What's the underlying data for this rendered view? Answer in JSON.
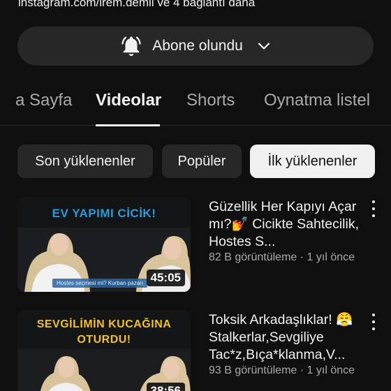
{
  "header": {
    "link_line": "instagram.com/irem.demil ve 4 bağlantı daha"
  },
  "subscribe": {
    "label": "Abone olundu",
    "icon": "bell-icon"
  },
  "tabs": [
    {
      "label": "a Sayfa",
      "active": false
    },
    {
      "label": "Videolar",
      "active": true
    },
    {
      "label": "Shorts",
      "active": false
    },
    {
      "label": "Oynatma listel",
      "active": false
    }
  ],
  "chips": [
    {
      "label": "Son yüklenenler",
      "selected": false
    },
    {
      "label": "Popüler",
      "selected": false
    },
    {
      "label": "İlk yüklenenler",
      "selected": true
    }
  ],
  "videos": [
    {
      "thumb_text": "EV YAPIMI CİCİK!",
      "thumb_subtitle": "Hostes seçmesi mi? Kurban pazarı",
      "duration": "45:05",
      "title": "Güzellik Her Kapıyı Açar mı?💅 Cicikte Sahtecilik, Hostes S...",
      "meta": "82 B görüntüleme · 1 yıl önce"
    },
    {
      "thumb_text_line1": "SEVGİLİMİN KUCAĞINA",
      "thumb_text_line2": "OTURDU!",
      "duration": "38:56",
      "title": "Toksik Arkadaşlıklar! 😤 Stalkerlar,Sevgiliye Tac*z,Bıça*klanma,V...",
      "meta": "93 B görüntüleme · 1 yıl önce"
    }
  ],
  "colors": {
    "background": "#0f0f0f",
    "chip": "#272727",
    "chip_selected": "#f1f1f1",
    "text_primary": "#f1f1f1",
    "text_secondary": "#aaaaaa",
    "thumb1_text": "#2a9bd8",
    "thumb2_text": "#f2c12e"
  }
}
